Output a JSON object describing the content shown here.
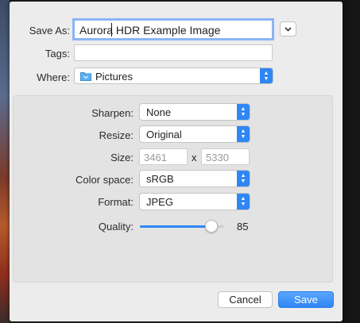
{
  "dialog": {
    "save_as_label": "Save As:",
    "save_as_value": "Aurora HDR Example Image",
    "tags_label": "Tags:",
    "tags_value": "",
    "where_label": "Where:",
    "where_value": "Pictures",
    "where_icon": "folder-icon"
  },
  "options": {
    "sharpen_label": "Sharpen:",
    "sharpen_value": "None",
    "resize_label": "Resize:",
    "resize_value": "Original",
    "size_label": "Size:",
    "width": "3461",
    "times": "x",
    "height": "5330",
    "colorspace_label": "Color space:",
    "colorspace_value": "sRGB",
    "format_label": "Format:",
    "format_value": "JPEG",
    "quality_label": "Quality:",
    "quality_value": "85",
    "quality_fraction": 0.85
  },
  "buttons": {
    "cancel": "Cancel",
    "save": "Save"
  },
  "colors": {
    "accent": "#2f86f5",
    "focus_ring": "#8ab4f8"
  }
}
